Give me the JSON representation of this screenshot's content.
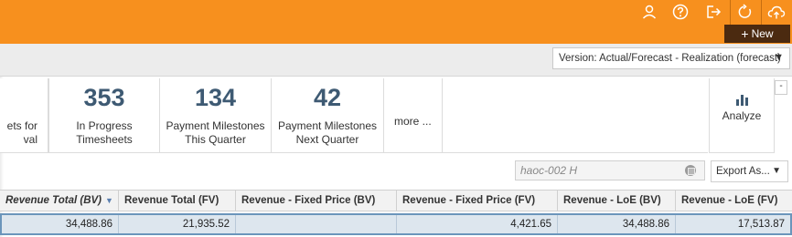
{
  "header": {
    "icons": [
      "user-icon",
      "help-icon",
      "logout-icon",
      "refresh-icon",
      "cloud-icon"
    ],
    "new_button": "New",
    "brand_color": "#f7901e"
  },
  "version": {
    "label": "Version: Actual/Forecast - Realization (forecast)"
  },
  "kpis": [
    {
      "value": "",
      "label_line1": "ets for",
      "label_line2": "val"
    },
    {
      "value": "353",
      "label_line1": "In Progress",
      "label_line2": "Timesheets"
    },
    {
      "value": "134",
      "label_line1": "Payment Milestones",
      "label_line2": "This Quarter"
    },
    {
      "value": "42",
      "label_line1": "Payment Milestones",
      "label_line2": "Next Quarter"
    }
  ],
  "more_label": "more ...",
  "analyze_label": "Analyze",
  "collapse_label": "-",
  "search": {
    "value": "haoc-002 H"
  },
  "export_label": "Export As...",
  "table": {
    "columns": [
      "Revenue Total (BV)",
      "Revenue Total (FV)",
      "Revenue - Fixed Price (BV)",
      "Revenue - Fixed Price (FV)",
      "Revenue - LoE (BV)",
      "Revenue - LoE (FV)"
    ],
    "rows": [
      [
        "34,488.86",
        "21,935.52",
        "",
        "4,421.65",
        "34,488.86",
        "17,513.87"
      ]
    ]
  }
}
